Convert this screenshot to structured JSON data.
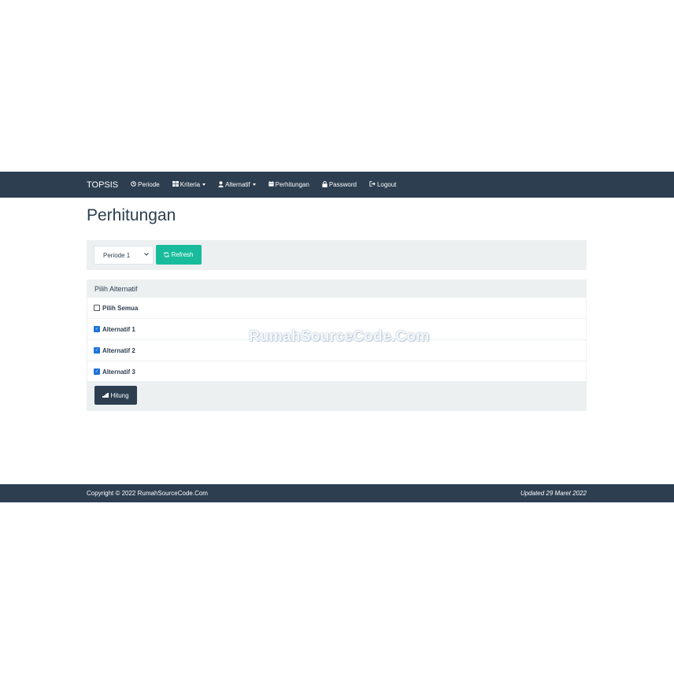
{
  "navbar": {
    "brand": "TOPSIS",
    "items": [
      {
        "label": "Periode",
        "icon": "clock-icon",
        "dropdown": false
      },
      {
        "label": "Kriteria",
        "icon": "grid-icon",
        "dropdown": true
      },
      {
        "label": "Alternatif",
        "icon": "user-icon",
        "dropdown": true
      },
      {
        "label": "Perhitungan",
        "icon": "calendar-icon",
        "dropdown": false
      },
      {
        "label": "Password",
        "icon": "lock-icon",
        "dropdown": false
      },
      {
        "label": "Logout",
        "icon": "logout-icon",
        "dropdown": false
      }
    ]
  },
  "page": {
    "title": "Perhitungan"
  },
  "filter": {
    "selected_periode": "Periode 1",
    "refresh_label": "Refresh"
  },
  "panel": {
    "heading": "Pilih Alternatif",
    "select_all": {
      "label": "Pilih Semua",
      "checked": false
    },
    "alternatives": [
      {
        "label": "Alternatif 1",
        "checked": true
      },
      {
        "label": "Alternatif 2",
        "checked": true
      },
      {
        "label": "Alternatif 3",
        "checked": true
      }
    ],
    "submit_label": "Hitung"
  },
  "watermark": "RumahSourceCode.Com",
  "footer": {
    "copyright": "Copyright © 2022 RumahSourceCode.Com",
    "updated": "Updated 29 Maret 2022"
  },
  "colors": {
    "primary": "#2c3e50",
    "success": "#18bc9c",
    "well": "#ecf0f1",
    "checkbox": "#1e73d8"
  }
}
